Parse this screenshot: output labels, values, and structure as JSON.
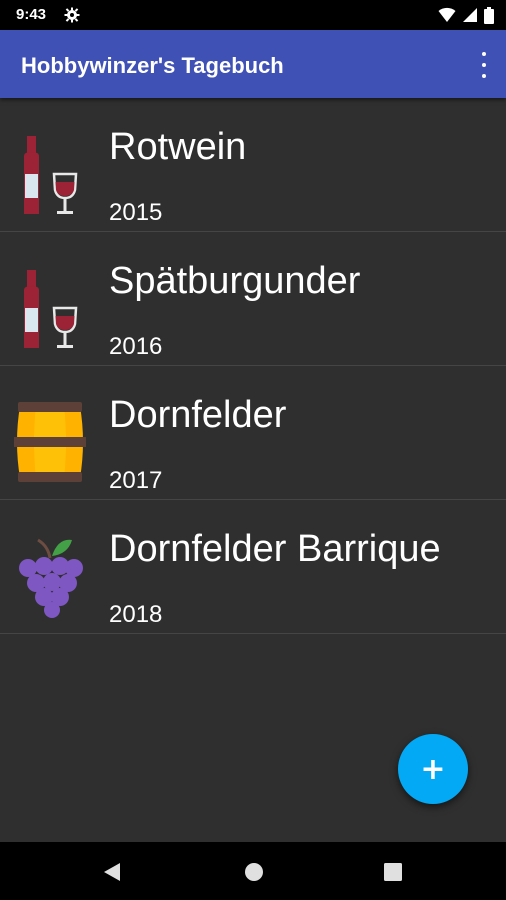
{
  "status_bar": {
    "time": "9:43",
    "icons": [
      "gear-icon",
      "wifi-icon",
      "signal-icon",
      "battery-icon"
    ]
  },
  "app_bar": {
    "title": "Hobbywinzer's Tagebuch",
    "overflow_icon": "more-vert-icon"
  },
  "wines": [
    {
      "name": "Rotwein",
      "year": "2015",
      "icon": "wine-bottle-glass-icon"
    },
    {
      "name": "Spätburgunder",
      "year": "2016",
      "icon": "wine-bottle-glass-icon"
    },
    {
      "name": "Dornfelder",
      "year": "2017",
      "icon": "barrel-icon"
    },
    {
      "name": "Dornfelder Barrique",
      "year": "2018",
      "icon": "grapes-icon"
    }
  ],
  "fab": {
    "label": "+",
    "icon": "add-icon"
  },
  "nav_bar": {
    "icons": [
      "back-icon",
      "home-icon",
      "recents-icon"
    ]
  },
  "colors": {
    "app_bar": "#3f51b5",
    "background": "#2f2f2f",
    "fab": "#03a9f4",
    "status_bar": "#000000"
  }
}
